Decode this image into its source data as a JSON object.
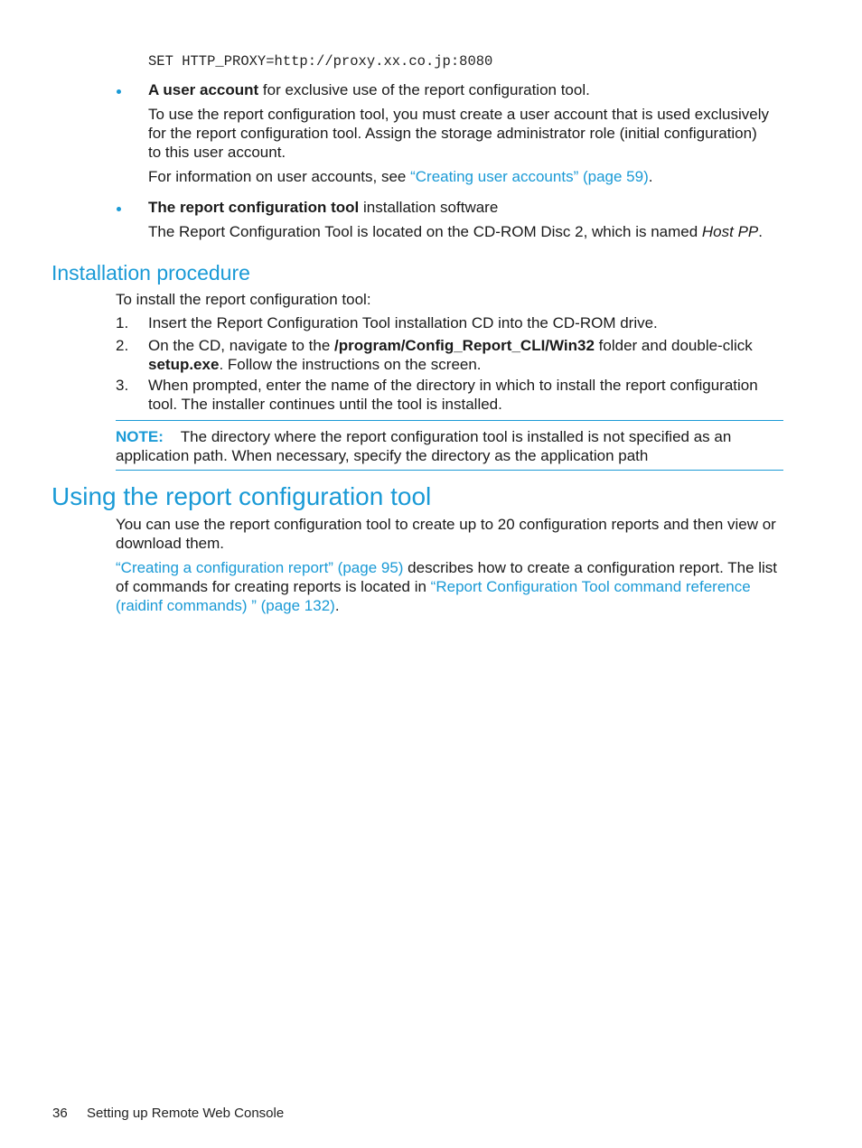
{
  "code_line": "SET HTTP_PROXY=http://proxy.xx.co.jp:8080",
  "bullets": [
    {
      "bold": "A user account",
      "rest": " for exclusive use of the report configuration tool.",
      "para1": "To use the report configuration tool, you must create a user account that is used exclusively for the report configuration tool. Assign the storage administrator role (initial configuration) to this user account.",
      "para2_prefix": "For information on user accounts, see ",
      "para2_link": "“Creating user accounts” (page 59)",
      "para2_suffix": "."
    },
    {
      "bold": "The report configuration tool",
      "rest": " installation software",
      "para1_prefix": "The Report Configuration Tool is located on the CD-ROM Disc 2, which is named ",
      "para1_italic": "Host PP",
      "para1_suffix": "."
    }
  ],
  "installation": {
    "heading": "Installation procedure",
    "intro": "To install the report configuration tool:",
    "steps": [
      {
        "num": "1.",
        "text": "Insert the Report Configuration Tool installation CD into the CD-ROM drive."
      },
      {
        "num": "2.",
        "prefix": "On the CD, navigate to the ",
        "bold1": "/program/Config_Report_CLI/Win32",
        "mid": " folder and double-click ",
        "bold2": "setup.exe",
        "suffix": ". Follow the instructions on the screen."
      },
      {
        "num": "3.",
        "text": "When prompted, enter the name of the directory in which to install the report configuration tool. The installer continues until the tool is installed."
      }
    ],
    "note_label": "NOTE:",
    "note_text": "The directory where the report configuration tool is installed is not specified as an application path. When necessary, specify the directory as the application path"
  },
  "using": {
    "heading": "Using the report configuration tool",
    "para1": "You can use the report configuration tool to create up to 20 configuration reports and then view or download them.",
    "para2_link1": "“Creating a configuration report” (page 95)",
    "para2_mid": " describes how to create a configuration report. The list of commands for creating reports is located in ",
    "para2_link2": "“Report Configuration Tool command reference (raidinf commands) ” (page 132)",
    "para2_suffix": "."
  },
  "footer": {
    "page_number": "36",
    "section": "Setting up Remote Web Console"
  }
}
